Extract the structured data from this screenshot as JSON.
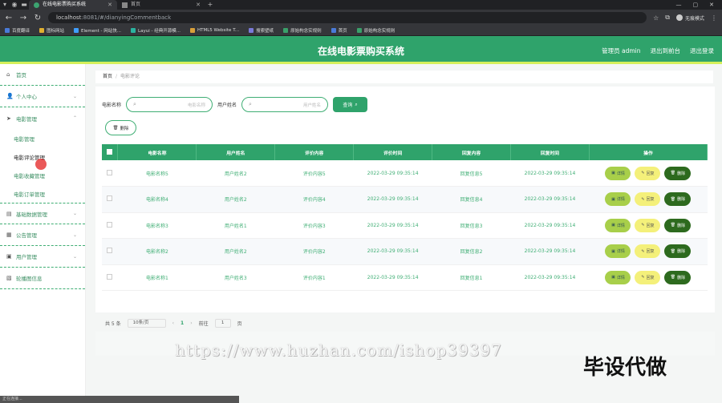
{
  "browser": {
    "tabs": [
      {
        "title": "在线电影票购买系统",
        "active": true
      },
      {
        "title": "首页",
        "active": false
      }
    ],
    "url_host": "localhost",
    "url_rest": ":8081/#/dianyingCommentback",
    "profile_label": "无痕模式",
    "bookmarks": [
      "百度翻译",
      "图标网站",
      "Element - 网站快...",
      "Layui - 经典开源模...",
      "HTML5 Website T...",
      "搜索壁纸",
      "原始构念实规则",
      "首页",
      "原始构念实规则"
    ]
  },
  "header": {
    "title": "在线电影票购买系统",
    "user": "管理员 admin",
    "back_to_front": "退出到前台",
    "logout": "退出登录"
  },
  "sidebar": {
    "items": [
      {
        "label": "首页"
      },
      {
        "label": "个人中心"
      },
      {
        "label": "电影管理"
      }
    ],
    "sub_items": [
      "电影管理",
      "电影评论管理",
      "电影收藏管理",
      "电影订单管理"
    ],
    "bottom_items": [
      {
        "label": "基础数据管理"
      },
      {
        "label": "公告管理"
      },
      {
        "label": "用户管理"
      },
      {
        "label": "轮播图信息"
      }
    ]
  },
  "breadcrumb": {
    "home": "首页",
    "sep": "/",
    "current": "电影评论"
  },
  "search": {
    "movie_label": "电影名称",
    "movie_placeholder": "电影名称",
    "user_label": "用户姓名",
    "user_placeholder": "用户姓名",
    "search_button": "查询",
    "delete_button": "删除"
  },
  "table": {
    "headers": [
      "电影名称",
      "用户姓名",
      "评价内容",
      "评价时间",
      "回复内容",
      "回复时间",
      "操作"
    ],
    "rows": [
      [
        "电影名称5",
        "用户姓名2",
        "评价内容5",
        "2022-03-29 09:35:14",
        "回复信息5",
        "2022-03-29 09:35:14"
      ],
      [
        "电影名称4",
        "用户姓名2",
        "评价内容4",
        "2022-03-29 09:35:14",
        "回复信息4",
        "2022-03-29 09:35:14"
      ],
      [
        "电影名称3",
        "用户姓名1",
        "评价内容3",
        "2022-03-29 09:35:14",
        "回复信息3",
        "2022-03-29 09:35:14"
      ],
      [
        "电影名称2",
        "用户姓名2",
        "评价内容2",
        "2022-03-29 09:35:14",
        "回复信息2",
        "2022-03-29 09:35:14"
      ],
      [
        "电影名称1",
        "用户姓名3",
        "评价内容1",
        "2022-03-29 09:35:14",
        "回复信息1",
        "2022-03-29 09:35:14"
      ]
    ],
    "op_detail": "详情",
    "op_reply": "回复",
    "op_delete": "删除"
  },
  "pager": {
    "total": "共 5 条",
    "page_size": "10条/页",
    "current_page": "1",
    "goto_label": "前往",
    "goto_value": "1",
    "page_suffix": "页"
  },
  "watermark": {
    "url": "https://www.huzhan.com/ishop39397",
    "text": "毕设代做"
  },
  "status_bar": "正在连接..."
}
